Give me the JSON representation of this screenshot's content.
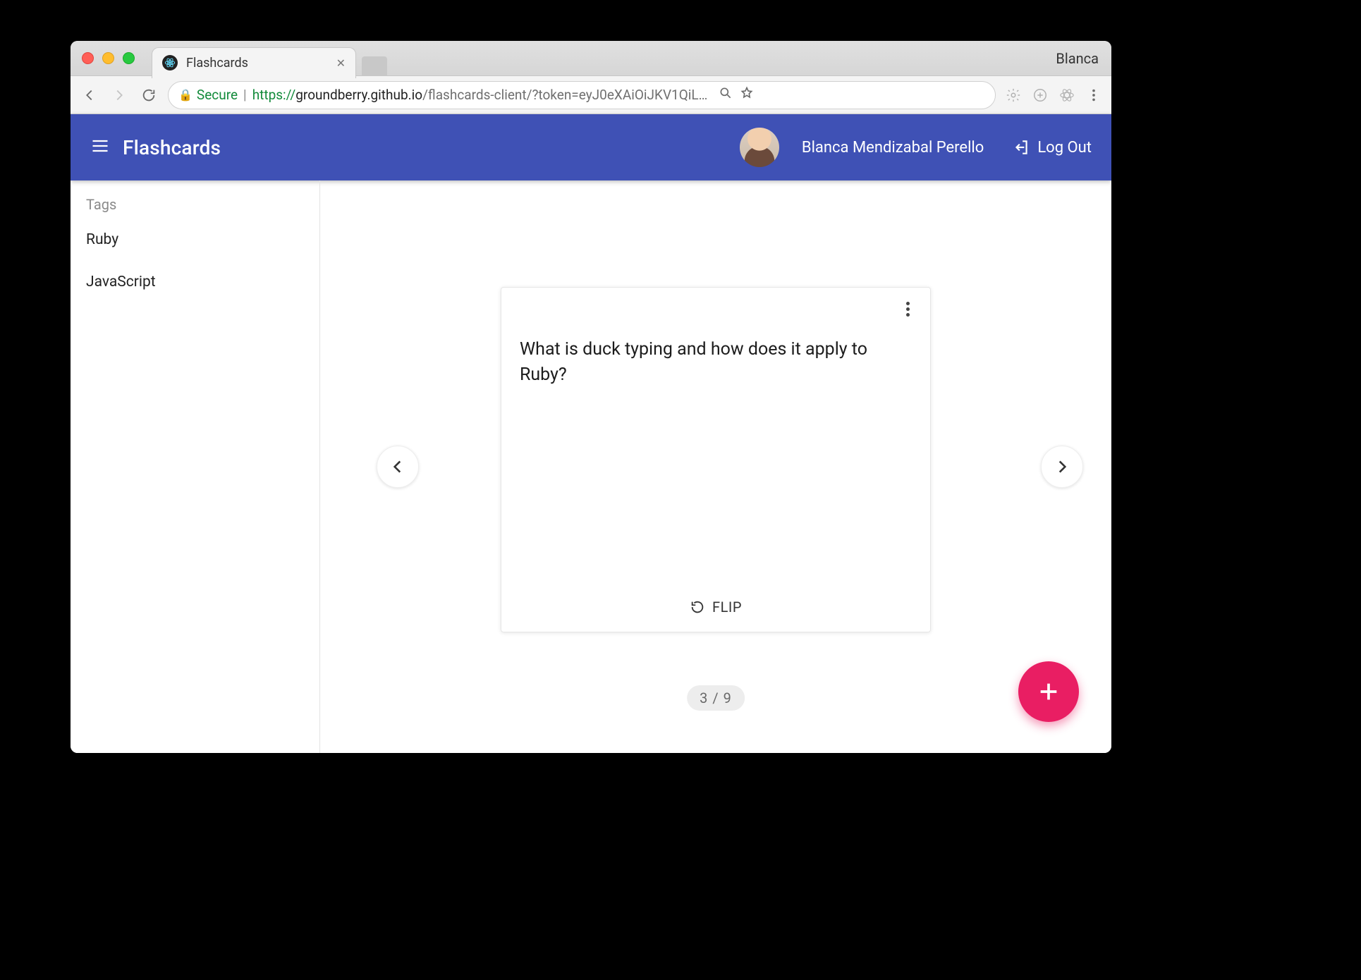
{
  "browser": {
    "tab_title": "Flashcards",
    "profile_name": "Blanca",
    "secure_label": "Secure",
    "url_proto": "https://",
    "url_host": "groundberry.github.io",
    "url_path": "/flashcards-client/?token=eyJ0eXAiOiJKV1QiL…"
  },
  "header": {
    "app_title": "Flashcards",
    "user_name": "Blanca Mendizabal Perello",
    "logout_label": "Log Out"
  },
  "sidebar": {
    "section_label": "Tags",
    "tags": [
      "Ruby",
      "JavaScript"
    ]
  },
  "card": {
    "question": "What is duck typing and how does it apply to Ruby?",
    "flip_label": "FLIP"
  },
  "pager": {
    "current": 3,
    "total": 9,
    "display": "3 / 9"
  }
}
